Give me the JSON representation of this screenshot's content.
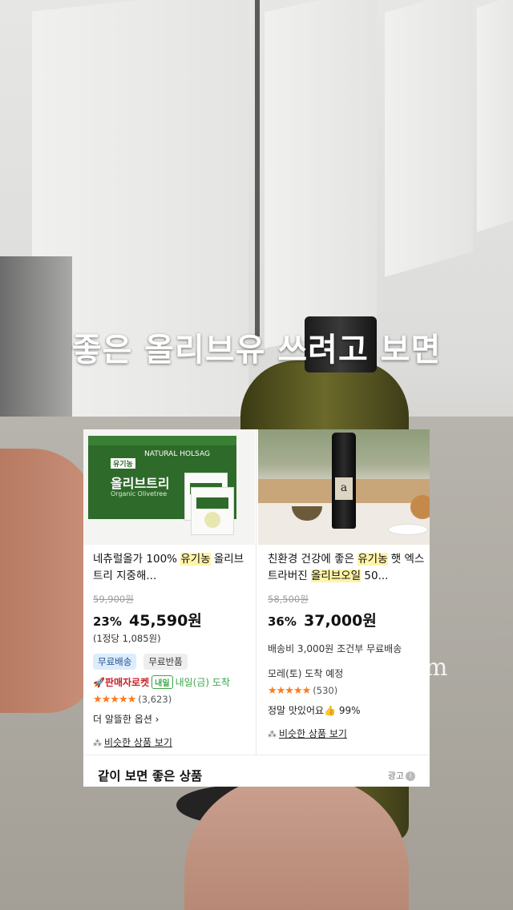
{
  "caption": "좋은 올리브유 쓰려고 보면",
  "watermark": "om",
  "products": [
    {
      "name_prefix": "네츄럴올가 100% ",
      "name_highlight": "유기농",
      "name_suffix": " 올리브트리 지중해...",
      "original_price": "59,900원",
      "discount": "23%",
      "price": "45,590원",
      "unit_price": "(1정당 1,085원)",
      "badges": [
        "무료배송",
        "무료반품"
      ],
      "rocket_label": "🚀판매자로켓",
      "rocket_badge": "내일",
      "rocket_arrival": "내일(금) 도착",
      "stars": "★★★★★",
      "review_count": "(3,623)",
      "more_options": "더 알뜰한 옵션 ›",
      "similar_link": "비슷한 상품 보기",
      "thumb": {
        "brand": "NATURAL HOLSAG",
        "tag": "유기농",
        "box_title": "올리브트리",
        "box_sub": "Organic Olivetree"
      }
    },
    {
      "name_prefix": "친환경 건강에 좋은 ",
      "name_highlight": "유기농",
      "name_middle": " 햇 엑스트라버진 ",
      "name_highlight2": "올리브오일",
      "name_suffix": " 50...",
      "original_price": "58,500원",
      "discount": "36%",
      "price": "37,000원",
      "shipping": "배송비 3,000원 조건부 무료배송",
      "eta": "모레(토) 도착 예정",
      "stars": "★★★★★",
      "review_count": "(530)",
      "satisfaction_label": "정말 맛있어요",
      "satisfaction_value": "99%",
      "similar_link": "비슷한 상품 보기",
      "thumb": {
        "label_letter": "a"
      }
    }
  ],
  "section_title": "같이 보면 좋은 상품",
  "ad_label": "광고",
  "icons": {
    "similar": "grid-icon",
    "info": "info-icon",
    "thumbs_up": "thumbs-up-icon"
  }
}
